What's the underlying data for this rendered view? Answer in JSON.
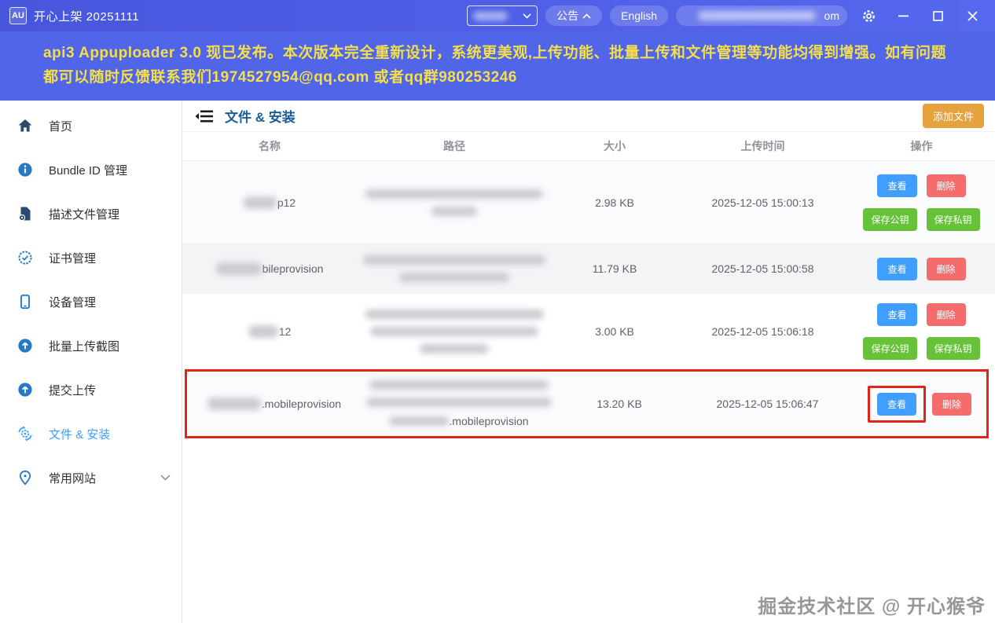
{
  "titlebar": {
    "app_logo": "AU",
    "title": "开心上架 20251111",
    "announcement_label": "公告",
    "language_label": "English",
    "account_visible_suffix": "om"
  },
  "banner": {
    "text": "api3 Appuploader 3.0 现已发布。本次版本完全重新设计，系统更美观,上传功能、批量上传和文件管理等功能均得到增强。如有问题都可以随时反馈联系我们1974527954@qq.com 或者qq群980253246"
  },
  "sidebar": {
    "items": [
      {
        "label": "首页",
        "icon": "home-icon",
        "active": false
      },
      {
        "label": "Bundle ID 管理",
        "icon": "info-circle-icon",
        "active": false
      },
      {
        "label": "描述文件管理",
        "icon": "file-gear-icon",
        "active": false
      },
      {
        "label": "证书管理",
        "icon": "certificate-badge-icon",
        "active": false
      },
      {
        "label": "设备管理",
        "icon": "smartphone-icon",
        "active": false
      },
      {
        "label": "批量上传截图",
        "icon": "upload-circle-icon",
        "active": false
      },
      {
        "label": "提交上传",
        "icon": "upload-circle-icon",
        "active": false
      },
      {
        "label": "文件 & 安装",
        "icon": "gear-sync-icon",
        "active": true
      },
      {
        "label": "常用网站",
        "icon": "location-pin-icon",
        "active": false,
        "expandable": true
      }
    ]
  },
  "main": {
    "page_title": "文件 & 安装",
    "add_file_button": "添加文件",
    "table": {
      "headers": [
        "名称",
        "路径",
        "大小",
        "上传时间",
        "操作"
      ],
      "rows": [
        {
          "name_visible": "p12",
          "size": "2.98 KB",
          "time": "2025-12-05 15:00:13"
        },
        {
          "name_visible": "bileprovision",
          "size": "11.79 KB",
          "time": "2025-12-05 15:00:58"
        },
        {
          "name_visible": "12",
          "size": "3.00 KB",
          "time": "2025-12-05 15:06:18"
        },
        {
          "name_visible": ".mobileprovision",
          "size": "13.20 KB",
          "time": "2025-12-05 15:06:47",
          "path_visible_suffix": ".mobileprovision",
          "highlighted": true
        }
      ]
    },
    "actions": {
      "view": "查看",
      "delete": "删除",
      "save_public": "保存公钥",
      "save_private": "保存私钥"
    }
  },
  "watermark": "掘金技术社区 @ 开心猴爷",
  "colors": {
    "titlebar": "#4856de",
    "banner": "#5065e8",
    "banner_text": "#f3df4a",
    "accent_blue": "#409eff",
    "danger_red": "#f56c6c",
    "success_green": "#67c23a",
    "warning_orange": "#e6a23c",
    "annotation_red": "#e1251b"
  }
}
